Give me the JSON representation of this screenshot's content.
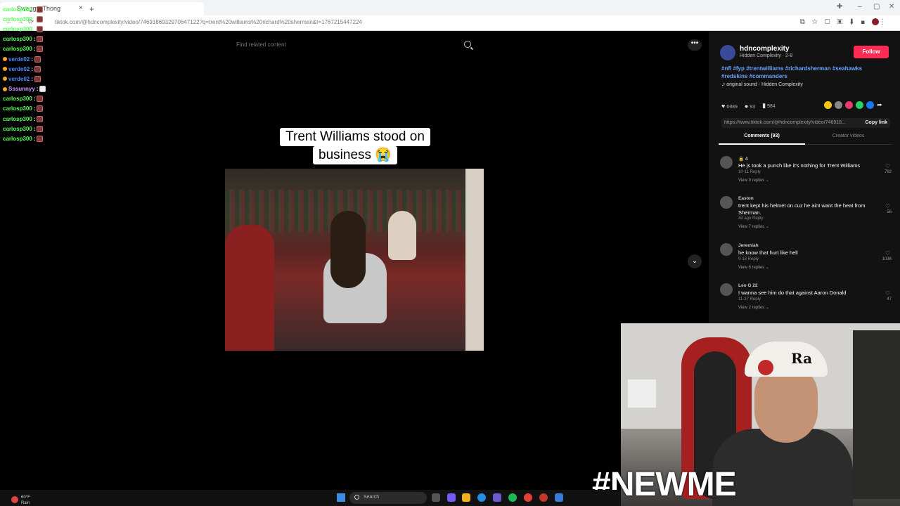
{
  "browser": {
    "tab_title": "SwaggysThong",
    "url": "tiktok.com/@hdncomplexity/video/7469186932970647122?q=trent%20williams%20richard%20sherman&t=1767215447224",
    "new_tab": "+",
    "close_tab": "×"
  },
  "chat": [
    {
      "name": "carlosp300",
      "color": "green"
    },
    {
      "name": "carlosp300",
      "color": "green"
    },
    {
      "name": "carlosp300",
      "color": "green"
    },
    {
      "name": "carlosp300",
      "color": "green"
    },
    {
      "name": "carlosp300",
      "color": "green"
    },
    {
      "name": "verde02",
      "color": "blue"
    },
    {
      "name": "verde02",
      "color": "blue"
    },
    {
      "name": "verde02",
      "color": "blue"
    },
    {
      "name": "Sssunnyy",
      "color": "purple"
    },
    {
      "name": "carlosp300",
      "color": "green"
    },
    {
      "name": "carlosp300",
      "color": "green"
    },
    {
      "name": "carlosp300",
      "color": "green"
    },
    {
      "name": "carlosp300",
      "color": "green"
    },
    {
      "name": "carlosp300",
      "color": "green"
    }
  ],
  "search": {
    "placeholder": "Find related content"
  },
  "video": {
    "caption_line1": "Trent Williams stood on",
    "caption_line2": "business 😭"
  },
  "author": {
    "name": "hdncomplexity",
    "subtitle": "Hidden Complexity · 2-8",
    "follow_label": "Follow",
    "hashtags": "#nfl #fyp #trentwilliams #richardsherman #seahawks #redskins #commanders",
    "sound": "♫  original sound - Hidden Complexity"
  },
  "stats": {
    "likes": "6989",
    "comments": "93",
    "saves": "984"
  },
  "link": {
    "url": "https://www.tiktok.com/@hdncomplexity/video/746918...",
    "copy_label": "Copy link"
  },
  "tabs": {
    "comments": "Comments (93)",
    "creator": "Creator videos"
  },
  "comments": [
    {
      "user": "🔒 4",
      "text": "He js took a punch like it's nothing for Trent Williams",
      "meta": "10-11    Reply",
      "replies": "View 9 replies ⌄",
      "likes": "782"
    },
    {
      "user": "Easton",
      "text": "trent kept his helmet on cuz he aint want the heat from Sherman.",
      "meta": "4d ago    Reply",
      "replies": "View 7 replies ⌄",
      "likes": "56"
    },
    {
      "user": "Jeremiah",
      "text": "he know that hurt like hell",
      "meta": "9-19    Reply",
      "replies": "View 6 replies ⌄",
      "likes": "1036"
    },
    {
      "user": "Leo G 22",
      "text": "I wanna see him do that against Aaron Donald",
      "meta": "11-27    Reply",
      "replies": "View 2 replies ⌄",
      "likes": "47"
    }
  ],
  "webcam": {
    "overlay_text": "#NEWME",
    "cap_text": "Ra"
  },
  "taskbar": {
    "weather_temp": "60°F",
    "weather_desc": "Rain",
    "search_label": "Search"
  },
  "colors": {
    "follow": "#fe2c55",
    "hashtag": "#6aa3ff",
    "chat_green": "#5bff5b",
    "chat_blue": "#4a8bff"
  }
}
